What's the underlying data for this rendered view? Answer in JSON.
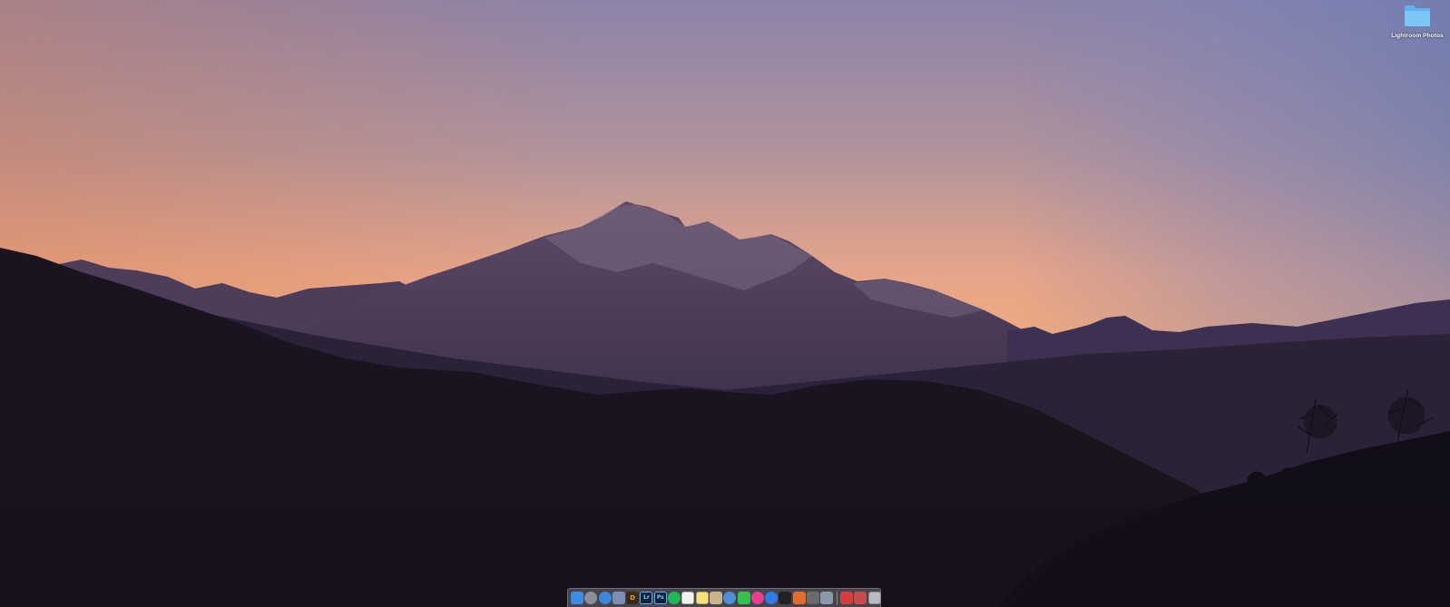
{
  "desktop": {
    "icons": [
      {
        "label": "Lightroom Photos",
        "icon": "folder-icon"
      }
    ]
  },
  "dock": {
    "apps": [
      {
        "name": "Finder",
        "icon": "finder-icon",
        "glyph": "",
        "color": "#3a8ee6",
        "running": true
      },
      {
        "name": "Launchpad",
        "icon": "launchpad-icon",
        "glyph": "",
        "color": "#8a8f99",
        "running": false
      },
      {
        "name": "Safari",
        "icon": "safari-icon",
        "glyph": "",
        "color": "#3d86d9",
        "running": true
      },
      {
        "name": "Preview",
        "icon": "preview-icon",
        "glyph": "",
        "color": "#7b8fb5",
        "running": true
      },
      {
        "name": "Dictionary",
        "icon": "dictionary-icon",
        "glyph": "D",
        "color": "#3a2a1a",
        "running": false
      },
      {
        "name": "Lightroom",
        "icon": "lightroom-icon",
        "glyph": "Lr",
        "color": "#0c2233",
        "running": false
      },
      {
        "name": "Photoshop",
        "icon": "photoshop-icon",
        "glyph": "Ps",
        "color": "#0a1f33",
        "running": false
      },
      {
        "name": "Spotify",
        "icon": "spotify-icon",
        "glyph": "",
        "color": "#1db954",
        "running": false
      },
      {
        "name": "Calendar",
        "icon": "calendar-icon",
        "glyph": "",
        "color": "#f2f2f2",
        "running": false
      },
      {
        "name": "Notes",
        "icon": "notes-icon",
        "glyph": "",
        "color": "#f7e27a",
        "running": false
      },
      {
        "name": "Contacts",
        "icon": "contacts-icon",
        "glyph": "",
        "color": "#c9b48a",
        "running": false
      },
      {
        "name": "Messages",
        "icon": "messages-icon",
        "glyph": "",
        "color": "#4a90d9",
        "running": false
      },
      {
        "name": "FaceTime",
        "icon": "facetime-icon",
        "glyph": "",
        "color": "#32c24d",
        "running": false
      },
      {
        "name": "iTunes",
        "icon": "itunes-icon",
        "glyph": "",
        "color": "#e83e8c",
        "running": false
      },
      {
        "name": "App Store",
        "icon": "app-store-icon",
        "glyph": "",
        "color": "#2a7ee6",
        "running": false
      },
      {
        "name": "Terminal",
        "icon": "terminal-icon",
        "glyph": "",
        "color": "#222222",
        "running": false
      },
      {
        "name": "Sublime Text",
        "icon": "sublime-icon",
        "glyph": "",
        "color": "#e36b2c",
        "running": false
      },
      {
        "name": "Screenshot",
        "icon": "screenshot-icon",
        "glyph": "",
        "color": "#6b6b6b",
        "running": false
      },
      {
        "name": "Photo Utility",
        "icon": "photo-utility-icon",
        "glyph": "",
        "color": "#8a9aaa",
        "running": true
      }
    ],
    "stacks": [
      {
        "name": "Downloads",
        "icon": "downloads-stack-icon",
        "color": "#d33f3f"
      },
      {
        "name": "Documents",
        "icon": "documents-stack-icon",
        "color": "#c94a4a"
      },
      {
        "name": "Trash",
        "icon": "trash-icon",
        "color": "#b8bcc2"
      }
    ]
  },
  "colors": {
    "sky_top": "#8a7fa6",
    "sky_horizon": "#f0a878",
    "sky_right": "#7e86b8",
    "mountain_dark": "#14101a",
    "dock_bg": "rgba(200,200,210,0.28)"
  }
}
